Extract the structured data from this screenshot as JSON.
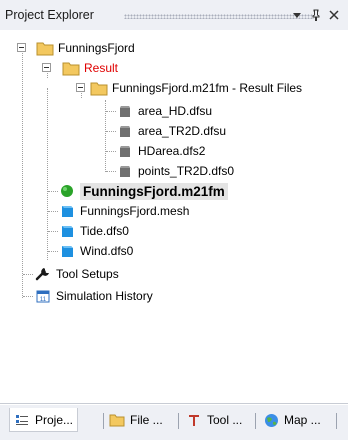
{
  "panel": {
    "title": "Project Explorer"
  },
  "tree": {
    "root": "FunningsFjord",
    "result": "Result",
    "result_files": "FunningsFjord.m21fm - Result Files",
    "files": [
      "area_HD.dfsu",
      "area_TR2D.dfsu",
      "HDarea.dfs2",
      "points_TR2D.dfs0"
    ],
    "model": "FunningsFjord.m21fm",
    "mesh": "FunningsFjord.mesh",
    "tide": "Tide.dfs0",
    "wind": "Wind.dfs0",
    "tool_setups": "Tool Setups",
    "simulation_history": "Simulation History"
  },
  "tabs": [
    {
      "label": "Proje..."
    },
    {
      "label": "File ..."
    },
    {
      "label": "Tool ..."
    },
    {
      "label": "Map ..."
    }
  ],
  "colors": {
    "folder": "#f3c85f",
    "result_text": "#e00000",
    "model_dot": "#2aa329",
    "data_file": "#1e90e0",
    "result_file": "#707070"
  }
}
